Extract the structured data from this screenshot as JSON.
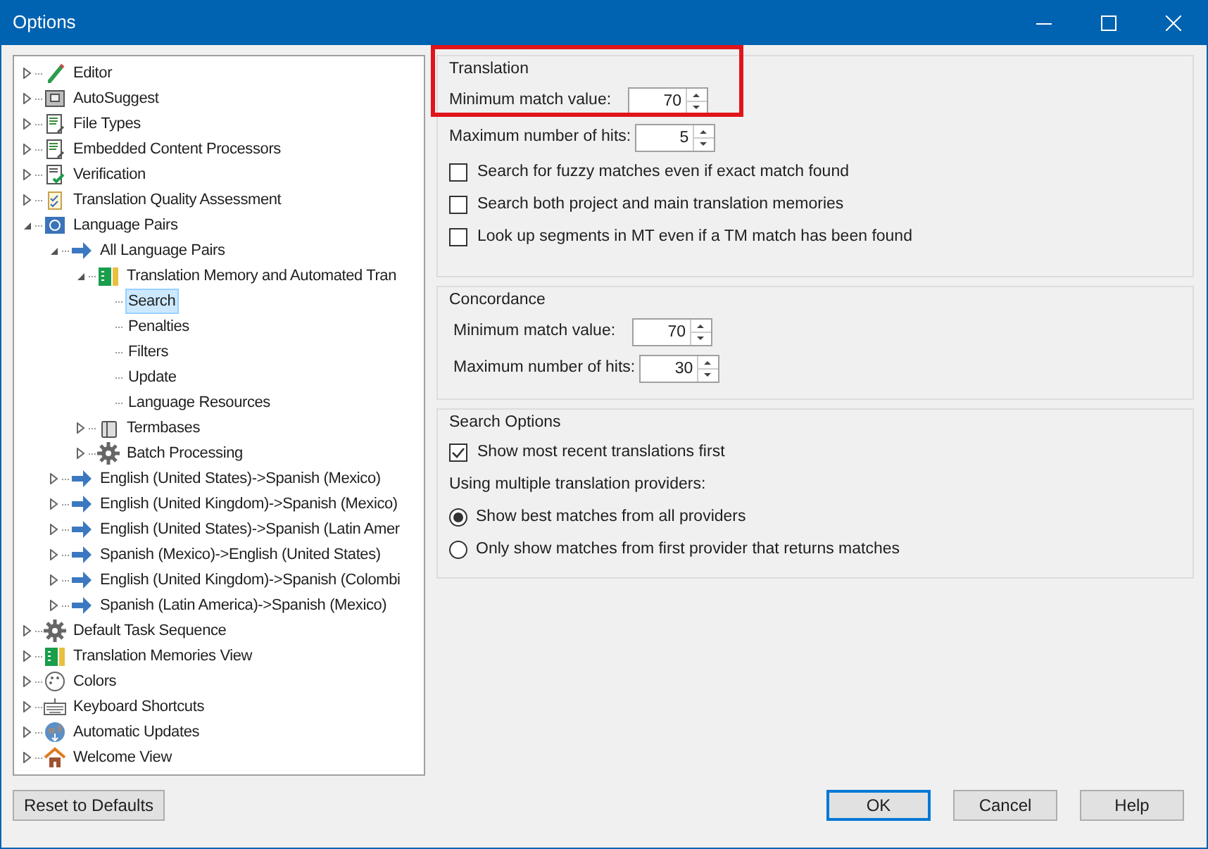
{
  "window": {
    "title": "Options"
  },
  "tree": [
    {
      "label": "Editor",
      "kind": "pencil",
      "expanded": false,
      "selected": false
    },
    {
      "label": "AutoSuggest",
      "kind": "box",
      "expanded": false,
      "selected": false
    },
    {
      "label": "File Types",
      "kind": "doc",
      "expanded": false,
      "selected": false
    },
    {
      "label": "Embedded Content Processors",
      "kind": "doc",
      "expanded": false,
      "selected": false
    },
    {
      "label": "Verification",
      "kind": "checkdoc",
      "expanded": false,
      "selected": false
    },
    {
      "label": "Translation Quality Assessment",
      "kind": "clipboard",
      "expanded": false,
      "selected": false
    },
    {
      "label": "Language Pairs",
      "kind": "pairs",
      "expanded": true,
      "selected": false,
      "children": [
        {
          "label": "All Language Pairs",
          "kind": "arrow",
          "expanded": true,
          "selected": false,
          "children": [
            {
              "label": "Translation Memory and Automated Tran",
              "kind": "tm",
              "expanded": true,
              "selected": false,
              "children": [
                {
                  "label": "Search",
                  "selected": true
                },
                {
                  "label": "Penalties",
                  "selected": false
                },
                {
                  "label": "Filters",
                  "selected": false
                },
                {
                  "label": "Update",
                  "selected": false
                },
                {
                  "label": "Language Resources",
                  "selected": false
                }
              ]
            },
            {
              "label": "Termbases",
              "kind": "termbase",
              "expanded": false,
              "selected": false
            },
            {
              "label": "Batch Processing",
              "kind": "gear",
              "expanded": false,
              "selected": false
            }
          ]
        },
        {
          "label": "English (United States)->Spanish (Mexico)",
          "kind": "arrow",
          "expanded": false,
          "selected": false
        },
        {
          "label": "English (United Kingdom)->Spanish (Mexico)",
          "kind": "arrow",
          "expanded": false,
          "selected": false
        },
        {
          "label": "English (United States)->Spanish (Latin Amer",
          "kind": "arrow",
          "expanded": false,
          "selected": false
        },
        {
          "label": "Spanish (Mexico)->English (United States)",
          "kind": "arrow",
          "expanded": false,
          "selected": false
        },
        {
          "label": "English (United Kingdom)->Spanish (Colombi",
          "kind": "arrow",
          "expanded": false,
          "selected": false
        },
        {
          "label": "Spanish (Latin America)->Spanish (Mexico)",
          "kind": "arrow",
          "expanded": false,
          "selected": false
        }
      ]
    },
    {
      "label": "Default Task Sequence",
      "kind": "gear",
      "expanded": false,
      "selected": false
    },
    {
      "label": "Translation Memories View",
      "kind": "tm",
      "expanded": false,
      "selected": false
    },
    {
      "label": "Colors",
      "kind": "palette",
      "expanded": false,
      "selected": false
    },
    {
      "label": "Keyboard Shortcuts",
      "kind": "keyboard",
      "expanded": false,
      "selected": false
    },
    {
      "label": "Automatic Updates",
      "kind": "globe",
      "expanded": false,
      "selected": false
    },
    {
      "label": "Welcome View",
      "kind": "house",
      "expanded": false,
      "selected": false
    }
  ],
  "groups": [
    {
      "title": "Translation",
      "highlighted": true,
      "items": [
        {
          "kind": "spin",
          "label": "Minimum match value:",
          "value": "70"
        },
        {
          "kind": "spin",
          "label": "Maximum number of hits:",
          "value": "5"
        },
        {
          "kind": "checkbox",
          "label": "Search for fuzzy matches even if exact match found",
          "checked": false
        },
        {
          "kind": "checkbox",
          "label": "Search both project and main translation memories",
          "checked": false
        },
        {
          "kind": "checkbox",
          "label": "Look up segments in MT even if a TM match has been found",
          "checked": false
        }
      ]
    },
    {
      "title": "Concordance",
      "highlighted": false,
      "items": [
        {
          "kind": "spin",
          "label": "Minimum match value:",
          "value": "70"
        },
        {
          "kind": "spin",
          "label": "Maximum number of hits:",
          "value": "30"
        }
      ]
    },
    {
      "title": "Search Options",
      "highlighted": false,
      "items": [
        {
          "kind": "checkbox",
          "label": "Show most recent translations first",
          "checked": true
        },
        {
          "kind": "text",
          "label": "Using multiple translation providers:"
        },
        {
          "kind": "radio",
          "label": "Show best matches from all providers",
          "selected": true
        },
        {
          "kind": "radio",
          "label": "Only show matches from first provider that returns matches",
          "selected": false
        }
      ]
    }
  ],
  "buttons": [
    {
      "label": "Reset to Defaults",
      "default": false
    },
    {
      "label": "OK",
      "default": true
    },
    {
      "label": "Cancel",
      "default": false
    },
    {
      "label": "Help",
      "default": false
    }
  ]
}
